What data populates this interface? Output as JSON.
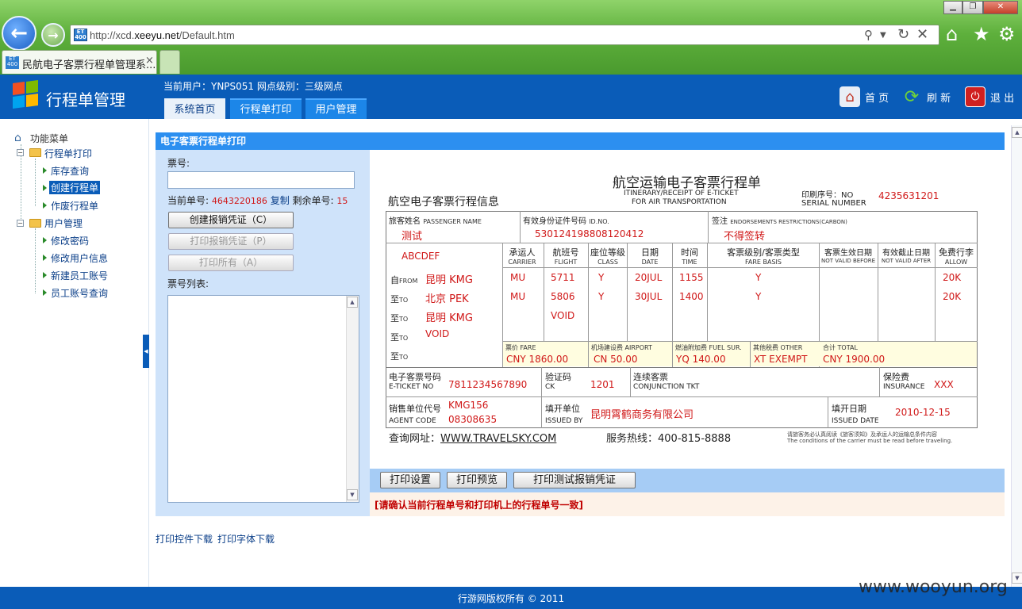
{
  "browser": {
    "url_prefix": "http://xcd.",
    "url_domain": "xeeyu.net",
    "url_path": "/Default.htm",
    "tab_title": "民航电子客票行程单管理系...",
    "favicon_text": "ET 400"
  },
  "app": {
    "title": "行程单管理",
    "current_user": "当前用户：YNPS051 网点级别：三级网点",
    "tabs": [
      "系统首页",
      "行程单打印",
      "用户管理"
    ],
    "header_buttons": {
      "home": "首 页",
      "refresh": "刷 新",
      "logout": "退 出"
    }
  },
  "menu": {
    "root": "功能菜单",
    "groups": [
      {
        "label": "行程单打印",
        "items": [
          "库存查询",
          "创建行程单",
          "作废行程单"
        ]
      },
      {
        "label": "用户管理",
        "items": [
          "修改密码",
          "修改用户信息",
          "新建员工账号",
          "员工账号查询"
        ]
      }
    ]
  },
  "panel": {
    "title": "电子客票行程单打印",
    "ticket_label": "票号:",
    "ticket_value": "",
    "current_no_label": "当前单号:",
    "current_no": "4643220186",
    "copy_link": "复制",
    "remain_label": "剩余单号:",
    "remain": "15",
    "btn_create": "创建报销凭证（C）",
    "btn_print": "打印报销凭证（P）",
    "btn_print_all": "打印所有（A）",
    "list_label": "票号列表:",
    "download_control": "打印控件下载",
    "download_font": "打印字体下载"
  },
  "itinerary": {
    "title_cn": "航空运输电子客票行程单",
    "title_en1": "ITINERARY/RECEIPT OF E-TICKET",
    "title_en2": "FOR AIR TRANSPORTATION",
    "info_title": "航空电子客票行程信息",
    "serial_label_cn": "印刷序号：NO",
    "serial_label_en": "SERIAL NUMBER",
    "serial_no": "4235631201",
    "passenger_label": "旅客姓名",
    "passenger_label_en": "PASSENGER NAME",
    "passenger": "测试",
    "id_label": "有效身份证件号码",
    "id_label_en": "ID.NO.",
    "id_no": "530124198808120412",
    "endorse_label": "签注",
    "endorse_label_en": "ENDORSEMENTS RESTRICTIONS(CARBON)",
    "endorse": "不得签转",
    "pnr": "ABCDEF",
    "col_headers": [
      {
        "cn": "承运人",
        "en": "CARRIER"
      },
      {
        "cn": "航班号",
        "en": "FLIGHT"
      },
      {
        "cn": "座位等级",
        "en": "CLASS"
      },
      {
        "cn": "日期",
        "en": "DATE"
      },
      {
        "cn": "时间",
        "en": "TIME"
      },
      {
        "cn": "客票级别/客票类型",
        "en": "FARE BASIS"
      },
      {
        "cn": "客票生效日期",
        "en": "NOT VALID BEFORE"
      },
      {
        "cn": "有效截止日期",
        "en": "NOT VALID AFTER"
      },
      {
        "cn": "免费行李",
        "en": "ALLOW"
      }
    ],
    "route_labels": [
      {
        "cn": "自",
        "en": "FROM"
      },
      {
        "cn": "至",
        "en": "TO"
      },
      {
        "cn": "至",
        "en": "TO"
      },
      {
        "cn": "至",
        "en": "TO"
      },
      {
        "cn": "至",
        "en": "TO"
      }
    ],
    "segments": [
      {
        "city": "昆明 KMG",
        "carrier": "MU",
        "flight": "5711",
        "class": "Y",
        "date": "20JUL",
        "time": "1155",
        "fare": "Y",
        "allow": "20K"
      },
      {
        "city": "北京 PEK",
        "carrier": "MU",
        "flight": "5806",
        "class": "Y",
        "date": "30JUL",
        "time": "1400",
        "fare": "Y",
        "allow": "20K"
      },
      {
        "city": "昆明 KMG",
        "carrier": "",
        "flight": "VOID",
        "class": "",
        "date": "",
        "time": "",
        "fare": "",
        "allow": ""
      },
      {
        "city": "VOID",
        "carrier": "",
        "flight": "",
        "class": "",
        "date": "",
        "time": "",
        "fare": "",
        "allow": ""
      },
      {
        "city": "",
        "carrier": "",
        "flight": "",
        "class": "",
        "date": "",
        "time": "",
        "fare": "",
        "allow": ""
      }
    ],
    "fare_label": "票价 FARE",
    "fare": "CNY 1860.00",
    "airport_label": "机场建设费 AIRPORT",
    "airport": "CN 50.00",
    "fuel_label": "燃油附加费 FUEL SUR.",
    "fuel": "YQ 140.00",
    "other_label": "其他税费 OTHER",
    "other": "XT EXEMPT",
    "total_label": "合计 TOTAL",
    "total": "CNY 1900.00",
    "eticket_label": "电子客票号码",
    "eticket_label_en": "E-TICKET NO",
    "eticket": "7811234567890",
    "ck_label": "验证码",
    "ck_label_en": "CK",
    "ck": "1201",
    "conj_label": "连续客票",
    "conj_label_en": "CONJUNCTION TKT",
    "ins_label": "保险费",
    "ins_label_en": "INSURANCE",
    "ins": "XXX",
    "agent_label": "销售单位代号",
    "agent_label_en": "AGENT CODE",
    "agent1": "KMG156",
    "agent2": "08308635",
    "issued_label": "填开单位",
    "issued_label_en": "ISSUED BY",
    "issued_by": "昆明霄鹤商务有限公司",
    "date_label": "填开日期",
    "date_label_en": "ISSUED DATE",
    "issued_date": "2010-12-15",
    "query_label": "查询网址：",
    "query_url": "WWW.TRAVELSKY.COM",
    "hotline": "服务热线：400-815-8888",
    "notice_cn": "请旅客务必认真阅读《旅客须知》及承运人的运输总条件内容",
    "notice_en": "The conditions of the carrier must be read before traveling."
  },
  "print_bar": {
    "settings": "打印设置",
    "preview": "打印预览",
    "test": "打印测试报销凭证",
    "warning": "[请确认当前行程单号和打印机上的行程单号一致]"
  },
  "footer": {
    "copyright": "行游网版权所有 © 2011",
    "watermark": "www.wooyun.org"
  },
  "colors": {
    "header_blue": "#0a5cb8",
    "panel_blue": "#2c8ff0",
    "form_bg": "#cfe3fa",
    "value_red": "#d01818"
  }
}
